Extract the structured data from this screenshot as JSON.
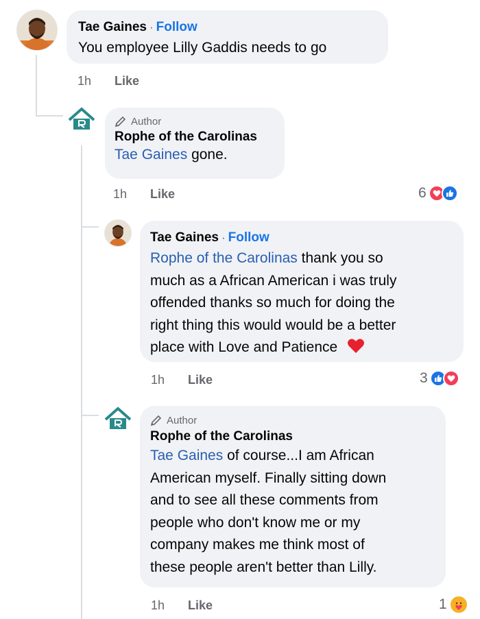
{
  "comments": [
    {
      "name": "Tae Gaines",
      "follow_label": "Follow",
      "separator": "·",
      "text": "You employee Lilly Gaddis needs to go",
      "time": "1h",
      "like_label": "Like"
    },
    {
      "author_badge": "Author",
      "name": "Rophe of the Carolinas",
      "mention": "Tae Gaines",
      "text": " gone.",
      "time": "1h",
      "like_label": "Like",
      "reaction_count": "6",
      "reactions": [
        "love",
        "like"
      ]
    },
    {
      "name": "Tae Gaines",
      "follow_label": "Follow",
      "separator": "·",
      "mention": "Rophe of the Carolinas",
      "text_lines": [
        " thank you so",
        "much as a African American i was truly",
        "offended thanks so much for doing the",
        "right thing this would would be a better",
        "place with Love and Patience"
      ],
      "emoji": "heart",
      "time": "1h",
      "like_label": "Like",
      "reaction_count": "3",
      "reactions": [
        "like",
        "love"
      ]
    },
    {
      "author_badge": "Author",
      "name": "Rophe of the Carolinas",
      "mention": "Tae Gaines",
      "text_lines": [
        " of course...I am African",
        "American myself. Finally sitting down",
        "and to see all these comments from",
        "people who don't know me or my",
        "company makes me think most of",
        "these people aren't better than Lilly."
      ],
      "time": "1h",
      "like_label": "Like",
      "reaction_count": "1",
      "reactions": [
        "care"
      ]
    }
  ],
  "colors": {
    "bubble": "#f0f2f5",
    "follow": "#1b74e4",
    "mention": "#2a5db0",
    "meta": "#65676b",
    "logo": "#2a8a8a"
  }
}
